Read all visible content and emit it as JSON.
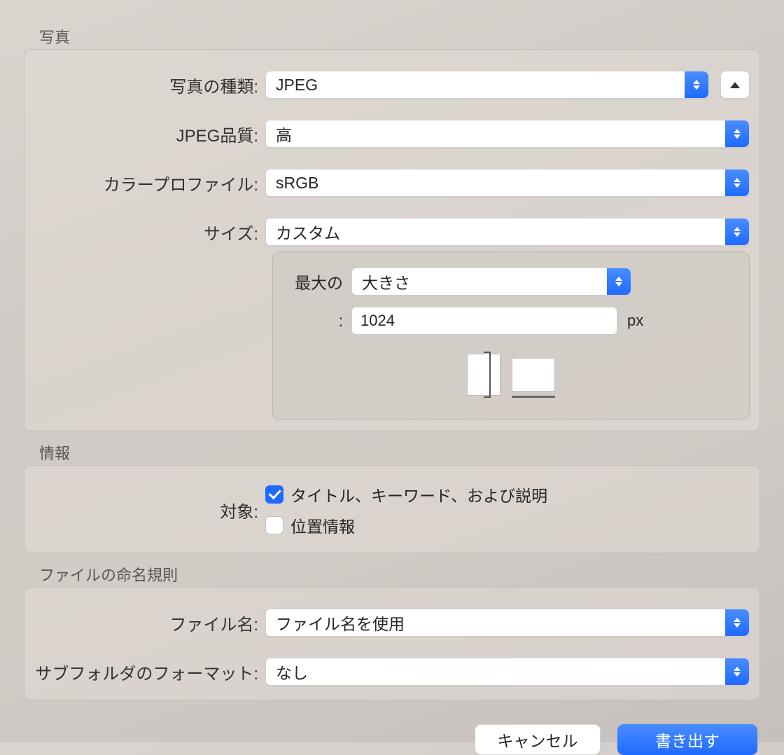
{
  "sections": {
    "photo": {
      "title": "写真",
      "photo_kind_label": "写真の種類:",
      "photo_kind_value": "JPEG",
      "jpeg_quality_label": "JPEG品質:",
      "jpeg_quality_value": "高",
      "color_profile_label": "カラープロファイル:",
      "color_profile_value": "sRGB",
      "size_label": "サイズ:",
      "size_value": "カスタム",
      "max_label": "最大の",
      "max_dimension_value": "大きさ",
      "colon": ":",
      "pixel_value": "1024",
      "pixel_unit": "px"
    },
    "info": {
      "title": "情報",
      "target_label": "対象:",
      "title_keywords_checked": true,
      "title_keywords_label": "タイトル、キーワード、および説明",
      "location_checked": false,
      "location_label": "位置情報"
    },
    "naming": {
      "title": "ファイルの命名規則",
      "filename_label": "ファイル名:",
      "filename_value": "ファイル名を使用",
      "subfolder_label": "サブフォルダのフォーマット:",
      "subfolder_value": "なし"
    }
  },
  "buttons": {
    "cancel": "キャンセル",
    "export": "書き出す"
  }
}
